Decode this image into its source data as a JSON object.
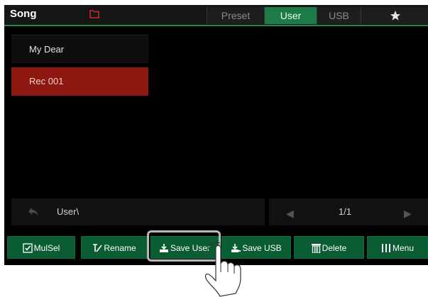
{
  "header": {
    "title": "Song",
    "tabs": [
      {
        "label": "Preset",
        "active": false
      },
      {
        "label": "User",
        "active": true
      },
      {
        "label": "USB",
        "active": false
      }
    ],
    "favorites_icon": "star-icon",
    "folder_icon": "folder-icon"
  },
  "file_list": {
    "items": [
      {
        "label": "My Dear",
        "selected": false
      },
      {
        "label": "Rec 001",
        "selected": true
      }
    ]
  },
  "path_bar": {
    "back_icon": "back-arrow-icon",
    "path": "User\\"
  },
  "pager": {
    "prev_icon": "triangle-left-icon",
    "page": "1/1",
    "next_icon": "triangle-right-icon"
  },
  "toolbar": {
    "mulsel": "MulSel",
    "rename": "Rename",
    "save_user": "Save User",
    "save_usb": "Save USB",
    "delete": "Delete",
    "menu": "Menu"
  },
  "colors": {
    "accent_green": "#0a5c33",
    "active_tab": "#1e7a46",
    "selected_item": "#8e1712",
    "folder_red": "#d0262a"
  },
  "annotation": {
    "pointer": "hand-pointer-icon",
    "highlighted_button": "Save User"
  }
}
